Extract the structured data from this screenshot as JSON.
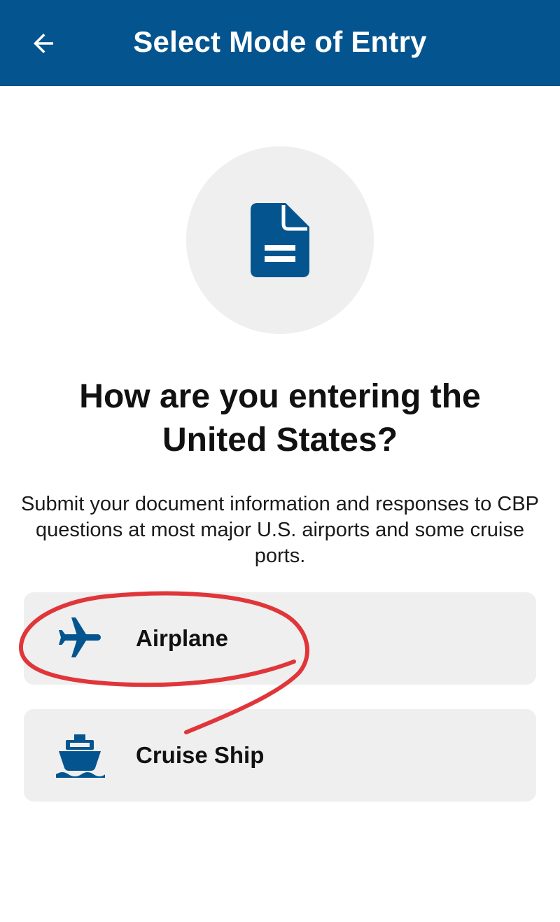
{
  "header": {
    "title": "Select Mode of Entry",
    "back_icon": "arrow-left-icon",
    "background_color": "#04548f"
  },
  "hero": {
    "icon": "document-icon",
    "icon_color": "#04548f"
  },
  "question": "How are you entering the United States?",
  "description": "Submit your document information and responses to CBP questions at most major U.S. airports and some cruise ports.",
  "options": [
    {
      "label": "Airplane",
      "icon": "airplane-icon"
    },
    {
      "label": "Cruise Ship",
      "icon": "ship-icon"
    }
  ],
  "annotation": {
    "shape": "hand-drawn-circle-around-airplane",
    "color": "#e0363a"
  }
}
